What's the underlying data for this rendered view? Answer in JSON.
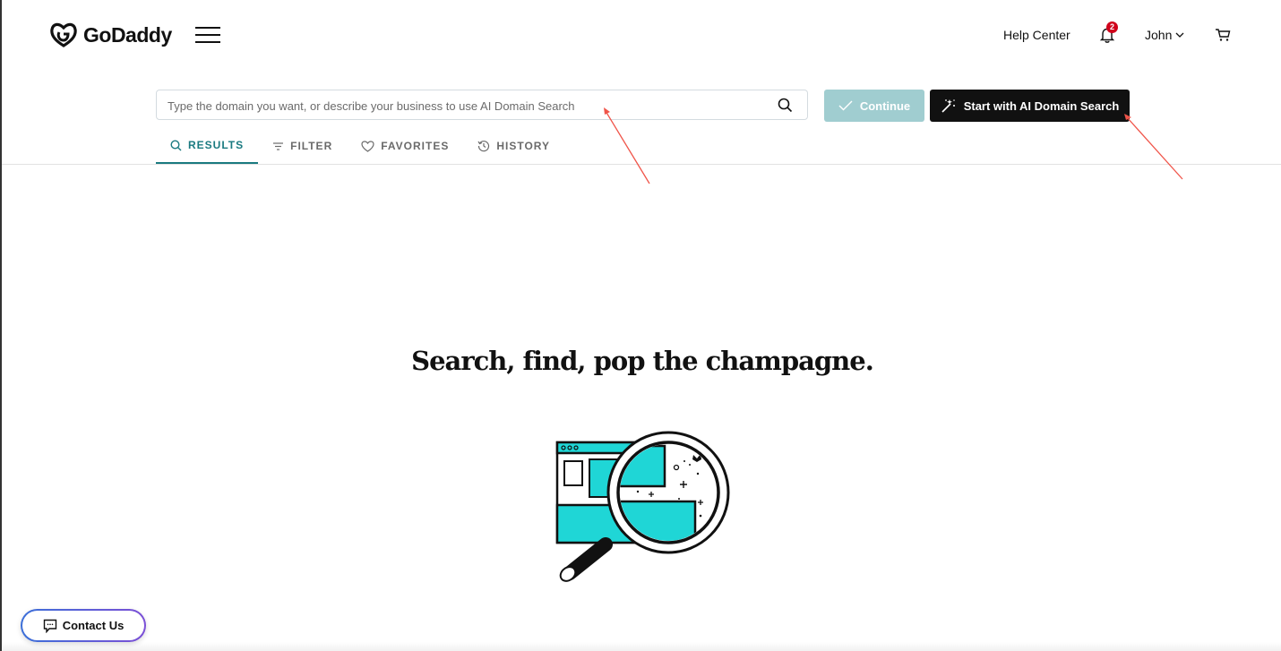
{
  "header": {
    "logo_text": "GoDaddy",
    "help_center": "Help Center",
    "notifications_count": "2",
    "user_name": "John"
  },
  "search": {
    "placeholder": "Type the domain you want, or describe your business to use AI Domain Search",
    "value": "",
    "continue_label": "Continue",
    "ai_search_label": "Start with AI Domain Search"
  },
  "tabs": [
    {
      "label": "RESULTS",
      "icon": "search-icon",
      "active": true
    },
    {
      "label": "FILTER",
      "icon": "filter-icon",
      "active": false
    },
    {
      "label": "FAVORITES",
      "icon": "heart-icon",
      "active": false
    },
    {
      "label": "HISTORY",
      "icon": "history-icon",
      "active": false
    }
  ],
  "main": {
    "headline": "Search, find, pop the champagne."
  },
  "contact": {
    "label": "Contact Us"
  },
  "colors": {
    "accent": "#1a7a80",
    "continue_bg": "#a0cdd0",
    "ai_button_bg": "#111111",
    "badge": "#d0021b",
    "illustration_cyan": "#1fd6d6",
    "annotation_arrow": "#f0554a"
  }
}
